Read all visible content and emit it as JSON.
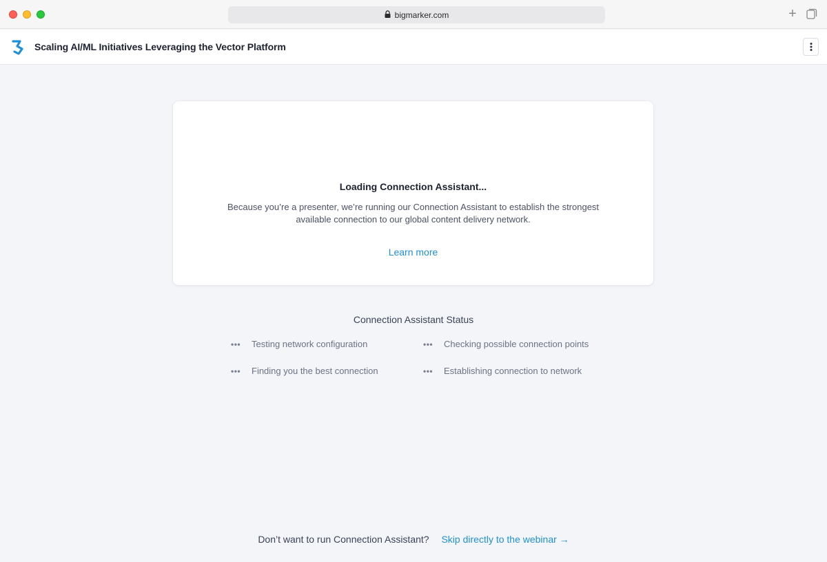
{
  "browser": {
    "url": "bigmarker.com"
  },
  "header": {
    "title": "Scaling AI/ML Initiatives Leveraging the Vector Platform"
  },
  "card": {
    "title": "Loading Connection Assistant...",
    "description_line1": "Because you’re a presenter, we’re running our Connection Assistant to establish the strongest",
    "description_line2": "available connection to our global content delivery network.",
    "learn_more": "Learn more"
  },
  "status": {
    "heading": "Connection Assistant Status",
    "items": [
      {
        "label": "Testing network configuration",
        "state_icon": "ellipsis-icon"
      },
      {
        "label": "Checking possible connection points",
        "state_icon": "ellipsis-icon"
      },
      {
        "label": "Finding you the best connection",
        "state_icon": "ellipsis-icon"
      },
      {
        "label": "Establishing connection to network",
        "state_icon": "ellipsis-icon"
      }
    ]
  },
  "footer": {
    "question": "Don’t want to run Connection Assistant?",
    "skip_link": "Skip directly to the webinar →"
  },
  "colors": {
    "accent": "#1e90d6",
    "spinner": "#1e8fd8",
    "background": "#f4f5f9"
  }
}
